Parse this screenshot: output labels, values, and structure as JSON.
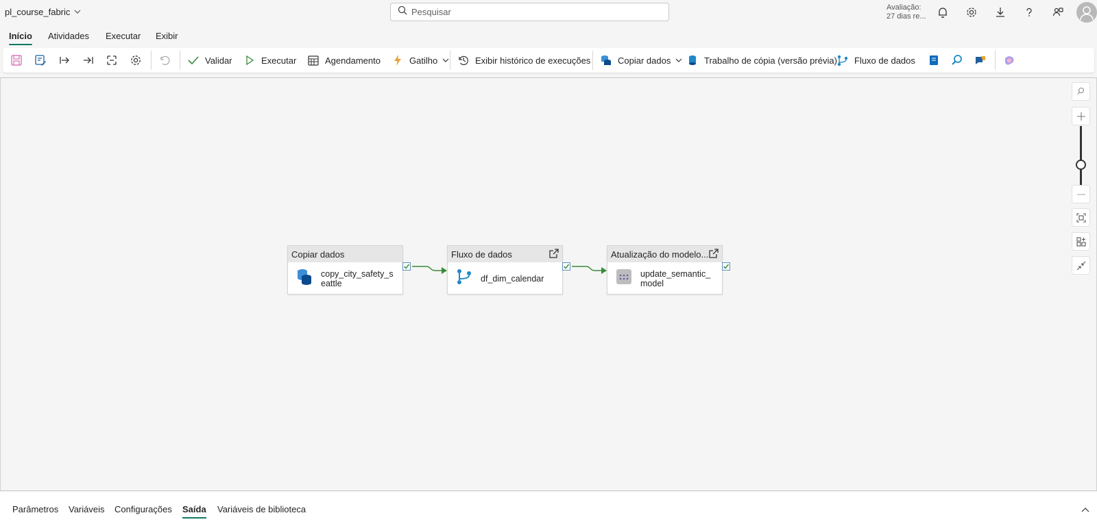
{
  "app": {
    "title": "pl_course_fabric"
  },
  "search": {
    "placeholder": "Pesquisar"
  },
  "trial": {
    "line1": "Avaliação:",
    "line2": "27 dias re..."
  },
  "tabs": [
    "Início",
    "Atividades",
    "Executar",
    "Exibir"
  ],
  "ribbon": {
    "validate": "Validar",
    "run": "Executar",
    "schedule": "Agendamento",
    "trigger": "Gatilho",
    "history": "Exibir histórico de execuções",
    "copy_data": "Copiar dados",
    "copy_job": "Trabalho de cópia (versão prévia)",
    "dataflow": "Fluxo de dados"
  },
  "pipeline": {
    "nodes": [
      {
        "type": "Copiar dados",
        "name": "copy_city_safety_seattle"
      },
      {
        "type": "Fluxo de dados",
        "name": "df_dim_calendar"
      },
      {
        "type": "Atualização do modelo...",
        "name": "update_semantic_model"
      }
    ]
  },
  "bottom_tabs": [
    "Parâmetros",
    "Variáveis",
    "Configurações",
    "Saída",
    "Variáveis de biblioteca"
  ],
  "active": {
    "tab": "Início",
    "bottom_tab": "Saída"
  },
  "colors": {
    "accent": "#117865",
    "success_arrow": "#3a8a3a",
    "node_header": "#e6e6e6"
  }
}
